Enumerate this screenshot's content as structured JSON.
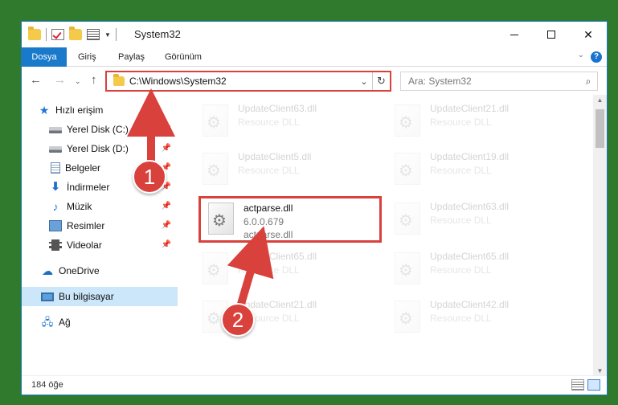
{
  "window": {
    "title": "System32"
  },
  "ribbon": {
    "tabs": [
      "Dosya",
      "Giriş",
      "Paylaş",
      "Görünüm"
    ],
    "help": "?"
  },
  "address_bar": {
    "path": "C:\\Windows\\System32",
    "dropdown_icon": "chevron-down-icon",
    "refresh_icon": "refresh-icon"
  },
  "search": {
    "placeholder": "Ara: System32"
  },
  "sidebar": {
    "items": [
      {
        "label": "Hızlı erişim",
        "icon": "star-icon"
      },
      {
        "label": "Yerel Disk (C:)",
        "icon": "drive-icon",
        "pinned": true
      },
      {
        "label": "Yerel Disk (D:)",
        "icon": "drive-icon",
        "pinned": true
      },
      {
        "label": "Belgeler",
        "icon": "document-icon",
        "pinned": true
      },
      {
        "label": "İndirmeler",
        "icon": "download-icon",
        "pinned": true
      },
      {
        "label": "Müzik",
        "icon": "music-icon",
        "pinned": true
      },
      {
        "label": "Resimler",
        "icon": "pictures-icon",
        "pinned": true
      },
      {
        "label": "Videolar",
        "icon": "video-icon",
        "pinned": true
      },
      {
        "label": "OneDrive",
        "icon": "cloud-icon"
      },
      {
        "label": "Bu bilgisayar",
        "icon": "computer-icon",
        "selected": true
      },
      {
        "label": "Ağ",
        "icon": "network-icon"
      }
    ]
  },
  "files": {
    "left_column": [
      {
        "name": "UpdateClient63.dll",
        "type": "Resource DLL",
        "faded": true
      },
      {
        "name": "UpdateClient5.dll",
        "type": "Resource DLL",
        "faded": true
      },
      {
        "name": "actparse.dll",
        "version": "6.0.0.679",
        "type": "actparse.dll",
        "highlighted": true
      },
      {
        "name": "UpdateClient65.dll",
        "type": "Resource DLL",
        "faded": true
      },
      {
        "name": "UpdateClient21.dll",
        "type": "Resource DLL",
        "faded": true
      }
    ],
    "right_column": [
      {
        "name": "UpdateClient21.dll",
        "type": "Resource DLL",
        "faded": true
      },
      {
        "name": "UpdateClient19.dll",
        "type": "Resource DLL",
        "faded": true
      },
      {
        "name": "UpdateClient63.dll",
        "type": "Resource DLL",
        "faded": true
      },
      {
        "name": "UpdateClient65.dll",
        "type": "Resource DLL",
        "faded": true
      },
      {
        "name": "UpdateClient42.dll",
        "type": "Resource DLL",
        "faded": true
      }
    ]
  },
  "status_bar": {
    "item_count": "184 öğe"
  },
  "annotations": {
    "callout_1": "1",
    "callout_2": "2",
    "color": "#d9413c"
  }
}
